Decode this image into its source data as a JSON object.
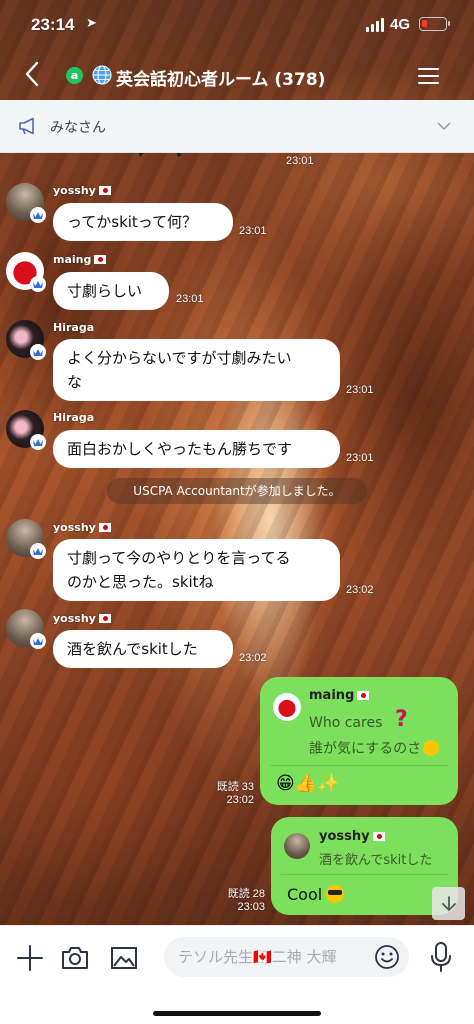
{
  "status_bar": {
    "time": "23:14",
    "network": "4G",
    "battery_level": 0.1
  },
  "header": {
    "title": "英会話初心者ルーム (378)",
    "open_chat_badge": "a"
  },
  "announcement": {
    "label": "みなさん"
  },
  "chat": {
    "top_time": "23:01",
    "messages": [
      {
        "sender": "yosshy",
        "text": "ってかskitって何？",
        "time": "23:01"
      },
      {
        "sender": "maing",
        "text": "寸劇らしい",
        "time": "23:01"
      },
      {
        "sender": "Hiraga",
        "text_line1": "よく分からないですが寸劇みたい",
        "text_line2": "な",
        "time": "23:01"
      },
      {
        "sender": "Hiraga",
        "text": "面白おかしくやったもん勝ちです",
        "time": "23:01"
      },
      {
        "sender": "yosshy",
        "text_line1": "寸劇って今のやりとりを言ってる",
        "text_line2": "のかと思った。skitね",
        "time": "23:02"
      },
      {
        "sender": "yosshy",
        "text": "酒を飲んでskitした",
        "time": "23:02"
      }
    ],
    "system_message": "USCPA Accountantが参加しました。",
    "my_messages": [
      {
        "quote_sender": "maing",
        "quote_line1": "Who cares",
        "quote_line2": "誰が気にするのさ",
        "reply": "😁👍✨",
        "read": "既読 33",
        "time": "23:02"
      },
      {
        "quote_sender": "yosshy",
        "quote_text": "酒を飲んでskitした",
        "reply": "Cool",
        "read": "既読 28",
        "time": "23:03"
      }
    ]
  },
  "input": {
    "placeholder": "テソル先生🇨🇦二神 大輝"
  },
  "colors": {
    "my_bubble": "#7de05c",
    "other_bubble": "#ffffff",
    "open_chat_green": "#22c35e",
    "crown_blue": "#2f6ee0"
  }
}
